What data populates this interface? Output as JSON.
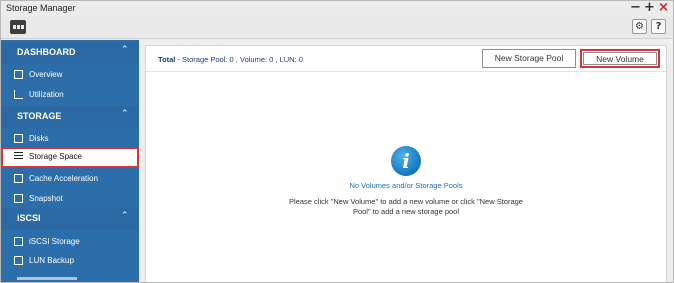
{
  "window": {
    "title": "Storage Manager",
    "controls": {
      "minimize": "−",
      "maximize": "+",
      "close": "×"
    }
  },
  "toolbar": {
    "settings_icon": "gear-icon",
    "settings_glyph": "⚙",
    "help_label": "?"
  },
  "sidebar": {
    "sections": [
      {
        "label": "DASHBOARD",
        "caret": "⌃",
        "items": [
          {
            "label": "Overview",
            "icon": "overview-icon"
          },
          {
            "label": "Utilization",
            "icon": "chart-icon"
          }
        ]
      },
      {
        "label": "STORAGE",
        "caret": "⌃",
        "items": [
          {
            "label": "Disks",
            "icon": "disk-icon"
          },
          {
            "label": "Storage Space",
            "icon": "storage-space-icon",
            "selected": true
          },
          {
            "label": "Cache Acceleration",
            "icon": "cache-icon"
          },
          {
            "label": "Snapshot",
            "icon": "snapshot-icon"
          }
        ]
      },
      {
        "label": "iSCSI",
        "caret": "⌃",
        "items": [
          {
            "label": "iSCSI Storage",
            "icon": "iscsi-storage-icon"
          },
          {
            "label": "LUN Backup",
            "icon": "lun-backup-icon"
          }
        ]
      }
    ]
  },
  "main": {
    "summary": {
      "prefix": "Total",
      "text": " - Storage Pool: 0 , Volume: 0 , LUN: 0"
    },
    "buttons": {
      "new_storage_pool": "New Storage Pool",
      "new_volume": "New Volume"
    },
    "empty_state": {
      "icon_glyph": "i",
      "title": "No Volumes and/or Storage Pools",
      "message": "Please click \"New Volume\" to add a new volume or click \"New Storage Pool\" to add a new storage pool"
    }
  },
  "colors": {
    "sidebar_bg": "#2c6eaa",
    "highlight": "#d9333a",
    "accent": "#1e6fb3"
  }
}
